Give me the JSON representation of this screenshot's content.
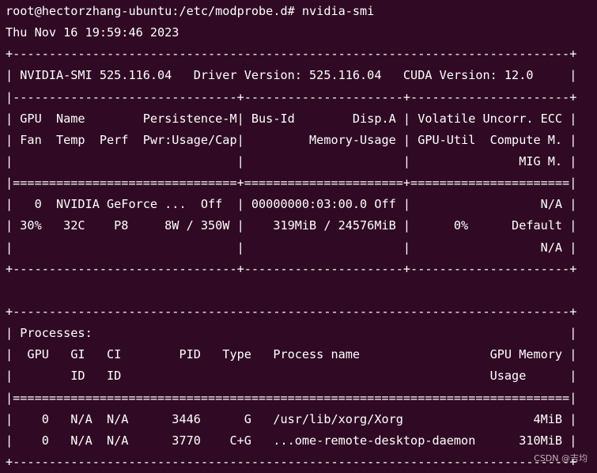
{
  "terminal": {
    "prompt": "root@hectorzhang-ubuntu:/etc/modprobe.d# nvidia-smi",
    "timestamp": "Thu Nov 16 19:59:46 2023",
    "gpu_table": {
      "top_border": "+-----------------------------------------------------------------------------+",
      "version_line": "| NVIDIA-SMI 525.116.04   Driver Version: 525.116.04   CUDA Version: 12.0     |",
      "version_separator": "|-------------------------------+----------------------+----------------------+",
      "header_line_1": "| GPU  Name        Persistence-M| Bus-Id        Disp.A | Volatile Uncorr. ECC |",
      "header_line_2": "| Fan  Temp  Perf  Pwr:Usage/Cap|         Memory-Usage | GPU-Util  Compute M. |",
      "header_line_3": "|                               |                      |               MIG M. |",
      "header_separator": "|===============================+======================+======================|",
      "gpu0_line_1": "|   0  NVIDIA GeForce ...  Off  | 00000000:03:00.0 Off |                  N/A |",
      "gpu0_line_2": "| 30%   32C    P8     8W / 350W |    319MiB / 24576MiB |      0%      Default |",
      "gpu0_line_3": "|                               |                      |                  N/A |",
      "bottom_border": "+-------------------------------+----------------------+----------------------+"
    },
    "process_table": {
      "top_border": "+-----------------------------------------------------------------------------+",
      "title_line": "| Processes:                                                                  |",
      "header_line_1": "|  GPU   GI   CI        PID   Type   Process name                  GPU Memory |",
      "header_line_2": "|        ID   ID                                                   Usage      |",
      "header_separator": "|=============================================================================|",
      "rows": [
        "|    0   N/A  N/A      3446      G   /usr/lib/xorg/Xorg                  4MiB |",
        "|    0   N/A  N/A      3770    C+G   ...ome-remote-desktop-daemon      310MiB |"
      ],
      "bottom_border": "+-----------------------------------------------------------------------------+"
    }
  },
  "watermark": "CSDN @吉均",
  "colors": {
    "background": "#300a24",
    "foreground": "#ffffff"
  }
}
